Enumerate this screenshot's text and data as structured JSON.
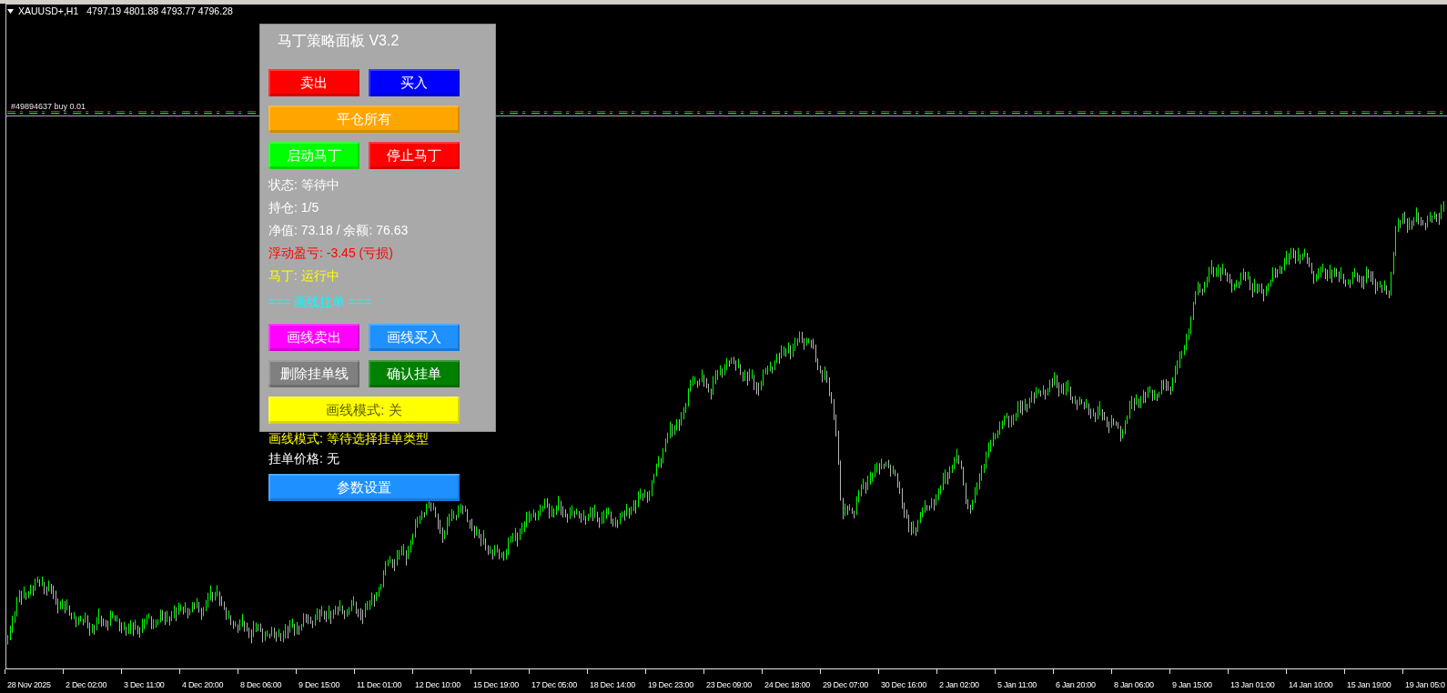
{
  "chart_header": {
    "symbol": "XAUUSD+,H1",
    "prices": "4797.19 4801.88 4793.77 4796.28"
  },
  "order_label": "#49894637 buy 0.01",
  "panel": {
    "title": "马丁策略面板 V3.2",
    "items": [
      {
        "kind": "buttons",
        "buttons": [
          {
            "label": "卖出",
            "color": "#ff0000"
          },
          {
            "label": "买入",
            "color": "#0000ff"
          }
        ]
      },
      {
        "kind": "buttons",
        "buttons": [
          {
            "label": "平仓所有",
            "color": "#ffa500"
          }
        ]
      },
      {
        "kind": "buttons",
        "buttons": [
          {
            "label": "启动马丁",
            "color": "#00ff00"
          },
          {
            "label": "停止马丁",
            "color": "#ff0000"
          }
        ]
      },
      {
        "kind": "text",
        "text": "状态: 等待中",
        "color": "#ffffff"
      },
      {
        "kind": "text",
        "text": "持仓: 1/5",
        "color": "#ffffff"
      },
      {
        "kind": "text",
        "text": "净值: 73.18 / 余额: 76.63",
        "color": "#ffffff"
      },
      {
        "kind": "text",
        "text": "浮动盈亏: -3.45 (亏损)",
        "color": "#ff0000"
      },
      {
        "kind": "text",
        "text": "马丁: 运行中",
        "color": "#ffff00"
      },
      {
        "kind": "section",
        "text": "=== 画线挂单 ===",
        "color": "#00ffff"
      },
      {
        "kind": "buttons",
        "buttons": [
          {
            "label": "画线卖出",
            "color": "#ff00ff"
          },
          {
            "label": "画线买入",
            "color": "#1e90ff"
          }
        ]
      },
      {
        "kind": "buttons",
        "buttons": [
          {
            "label": "删除挂单线",
            "color": "#808080"
          },
          {
            "label": "确认挂单",
            "color": "#008000"
          }
        ]
      },
      {
        "kind": "buttons",
        "buttons": [
          {
            "label": "画线模式: 关",
            "color": "#ffff00"
          }
        ]
      }
    ]
  },
  "below_panel": [
    {
      "kind": "text",
      "text": "画线模式: 等待选择挂单类型",
      "color": "#ffff00"
    },
    {
      "kind": "text",
      "text": "挂单价格: 无",
      "color": "#ffffff"
    },
    {
      "kind": "buttons",
      "buttons": [
        {
          "label": "参数设置",
          "color": "#1e90ff"
        }
      ]
    }
  ],
  "time_axis": {
    "labels": [
      "28 Nov 2025",
      "2 Dec 02:00",
      "3 Dec 11:00",
      "4 Dec 20:00",
      "8 Dec 06:00",
      "9 Dec 15:00",
      "11 Dec 01:00",
      "12 Dec 10:00",
      "15 Dec 19:00",
      "17 Dec 05:00",
      "18 Dec 14:00",
      "19 Dec 23:00",
      "23 Dec 09:00",
      "24 Dec 18:00",
      "29 Dec 07:00",
      "30 Dec 16:00",
      "2 Jan 02:00",
      "5 Jan 11:00",
      "6 Jan 20:00",
      "8 Jan 06:00",
      "9 Jan 15:00",
      "13 Jan 01:00",
      "14 Jan 10:00",
      "15 Jan 19:00",
      "19 Jan 05:0"
    ]
  }
}
